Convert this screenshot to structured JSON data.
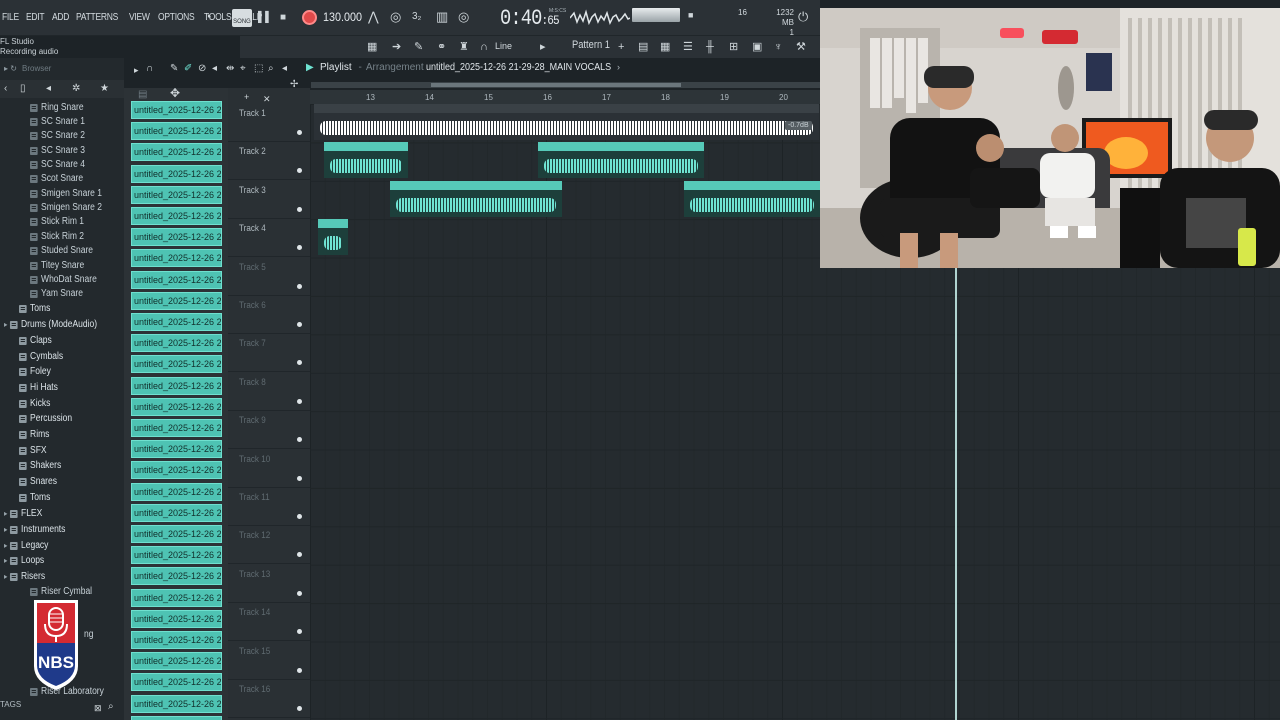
{
  "menu": [
    "FILE",
    "EDIT",
    "ADD",
    "PATTERNS",
    "VIEW",
    "OPTIONS",
    "TOOLS",
    "HELP"
  ],
  "hint": {
    "app": "FL Studio",
    "status": "Recording audio"
  },
  "transport": {
    "mode": "SONG",
    "tempo": "130.000",
    "time_main": "0:40",
    "time_sub": "65",
    "time_label": "M:S:CS"
  },
  "meters": {
    "voices": "16",
    "memory": "1232 MB",
    "memory_sub": "1"
  },
  "toolbar": {
    "snap": "Line",
    "pattern": "Pattern 1"
  },
  "browser": {
    "title": "Browser",
    "items": [
      {
        "label": "Ring Snare",
        "type": "file"
      },
      {
        "label": "SC Snare 1",
        "type": "file"
      },
      {
        "label": "SC Snare 2",
        "type": "file"
      },
      {
        "label": "SC Snare 3",
        "type": "file"
      },
      {
        "label": "SC Snare 4",
        "type": "file"
      },
      {
        "label": "Scot Snare",
        "type": "file"
      },
      {
        "label": "Smigen Snare 1",
        "type": "file"
      },
      {
        "label": "Smigen Snare 2",
        "type": "file"
      },
      {
        "label": "Stick Rim 1",
        "type": "file"
      },
      {
        "label": "Stick Rim 2",
        "type": "file"
      },
      {
        "label": "Studed Snare",
        "type": "file"
      },
      {
        "label": "Titey Snare",
        "type": "file"
      },
      {
        "label": "WhoDat Snare",
        "type": "file"
      },
      {
        "label": "Yam Snare",
        "type": "file"
      },
      {
        "label": "Toms",
        "type": "folder"
      },
      {
        "label": "Drums (ModeAudio)",
        "type": "folder-open"
      },
      {
        "label": "Claps",
        "type": "folder"
      },
      {
        "label": "Cymbals",
        "type": "folder"
      },
      {
        "label": "Foley",
        "type": "folder"
      },
      {
        "label": "Hi Hats",
        "type": "folder"
      },
      {
        "label": "Kicks",
        "type": "folder"
      },
      {
        "label": "Percussion",
        "type": "folder"
      },
      {
        "label": "Rims",
        "type": "folder"
      },
      {
        "label": "SFX",
        "type": "folder"
      },
      {
        "label": "Shakers",
        "type": "folder"
      },
      {
        "label": "Snares",
        "type": "folder"
      },
      {
        "label": "Toms",
        "type": "folder"
      },
      {
        "label": "FLEX",
        "type": "folder-root"
      },
      {
        "label": "Instruments",
        "type": "folder-root"
      },
      {
        "label": "Legacy",
        "type": "folder-root"
      },
      {
        "label": "Loops",
        "type": "folder-root"
      },
      {
        "label": "Risers",
        "type": "folder-root"
      },
      {
        "label": "Riser Cymbal",
        "type": "file"
      },
      {
        "label": "ng",
        "type": "file"
      },
      {
        "label": "Riser Laboratory",
        "type": "file"
      }
    ],
    "tags": "TAGS"
  },
  "channels": {
    "label": "untitled_2025-12-26 21-",
    "count": 30
  },
  "playlist": {
    "title": "Playlist",
    "sub": "Arrangement",
    "file": "untitled_2025-12-26 21-29-28_MAIN VOCALS",
    "ruler": [
      "13",
      "14",
      "15",
      "16",
      "17",
      "18",
      "19",
      "20"
    ],
    "tracks": [
      "Track 1",
      "Track 2",
      "Track 3",
      "Track 4",
      "Track 5",
      "Track 6",
      "Track 7",
      "Track 8",
      "Track 9",
      "Track 10",
      "Track 11",
      "Track 12",
      "Track 13",
      "Track 14",
      "Track 15",
      "Track 16"
    ],
    "clips": [
      {
        "label": "BOMBAI Type Beat (ALORCITO CUMBIA CHETA Type Beat [2]",
        "track": 1,
        "start": 0,
        "len": 505,
        "style": "white"
      },
      {
        "label": "untitled_20..AIN VOCALS",
        "track": 2,
        "start": 10,
        "len": 84,
        "style": "teal"
      },
      {
        "label": "untitled_2025-12-26 21-15-55_MAIN VOCALS",
        "track": 2,
        "start": 224,
        "len": 166,
        "style": "teal"
      },
      {
        "label": "untitled_2025-12-26 21-06-59_MAIN VOCALS",
        "track": 3,
        "start": 76,
        "len": 172,
        "style": "teal"
      },
      {
        "label": "untitled_2025-12-26 21-20-35_MAIN V",
        "track": 3,
        "start": 370,
        "len": 140,
        "style": "teal"
      },
      {
        "label": "unt..3",
        "track": 4,
        "start": 4,
        "len": 30,
        "style": "teal"
      }
    ],
    "volume_badge": "-0.7dB"
  }
}
